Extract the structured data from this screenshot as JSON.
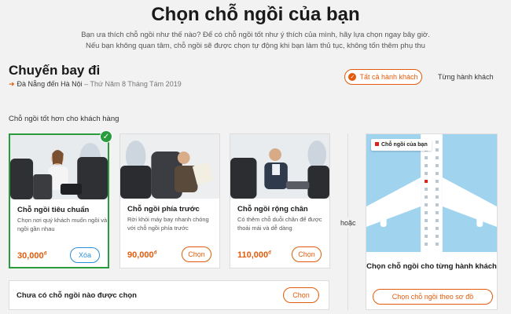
{
  "header": {
    "title": "Chọn chỗ ngồi của bạn",
    "subtitle": "Bạn ưa thích chỗ ngồi như thế nào? Để có chỗ ngồi tốt như ý thích của mình, hãy lựa chọn ngay bây giờ. Nếu bạn không quan tâm, chỗ ngồi sẽ được chọn tự động khi bạn làm thủ tục, không tốn thêm phụ thu"
  },
  "flight": {
    "title": "Chuyến bay đi",
    "route": "Đà Nẵng đến Hà Nội",
    "date": " – Thứ Năm 8 Tháng Tám 2019"
  },
  "passenger_toggle": {
    "all_label": "Tất cả hành khách",
    "each_label": "Từng hành khách"
  },
  "section": {
    "better_seat_label": "Chỗ ngồi tốt hơn cho khách hàng"
  },
  "cards": [
    {
      "name": "Chỗ ngồi tiêu chuẩn",
      "desc": "Chọn nơi quý khách muốn ngồi và ngồi gần nhau",
      "price": "30,000",
      "currency": "đ",
      "button": "Xóa"
    },
    {
      "name": "Chỗ ngồi phía trước",
      "desc": "Rời khỏi máy bay nhanh chóng với chỗ ngồi phía trước",
      "price": "90,000",
      "currency": "đ",
      "button": "Chọn"
    },
    {
      "name": "Chỗ ngồi rộng chân",
      "desc": "Có thêm chỗ duỗi chân để được thoải mái và dễ dàng",
      "price": "110,000",
      "currency": "đ",
      "button": "Chọn"
    }
  ],
  "or_label": "hoặc",
  "seat_map": {
    "tag_label": "Chỗ ngồi của bạn",
    "title": "Chọn chỗ ngồi cho từng hành khách",
    "button": "Chọn chỗ ngồi theo sơ đồ"
  },
  "no_seat": {
    "text": "Chưa có chỗ ngồi nào được chọn",
    "button": "Chọn"
  },
  "colors": {
    "accent": "#e35b0a",
    "selected": "#2a9c3e",
    "map_bg": "#9fd3ee"
  }
}
